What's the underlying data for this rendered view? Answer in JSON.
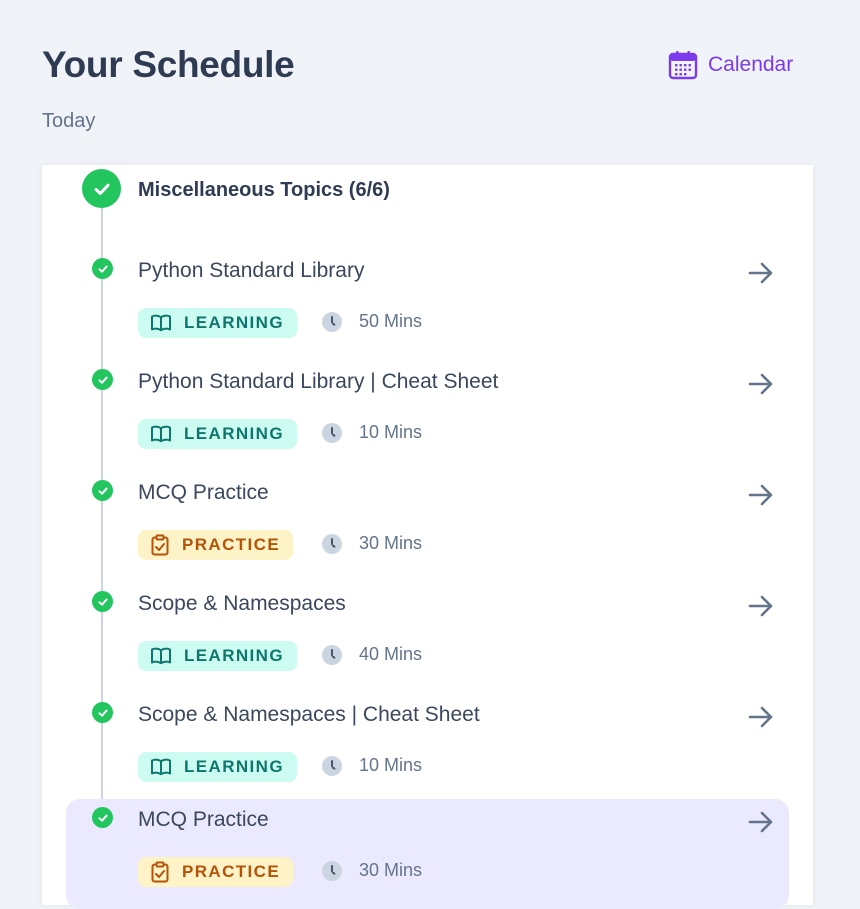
{
  "header": {
    "title": "Your Schedule",
    "calendar_label": "Calendar",
    "calendar_icon": "calendar-icon",
    "subtitle": "Today"
  },
  "group": {
    "title": "Miscellaneous Topics (6/6)",
    "status": "completed"
  },
  "colors": {
    "accent": "#7c3aed",
    "success": "#22c55e",
    "learning_bg": "#ccfbf1",
    "learning_fg": "#0f766e",
    "practice_bg": "#fef3c7",
    "practice_fg": "#b45309",
    "selected_bg": "#ebe9fe"
  },
  "items": [
    {
      "name": "Python Standard Library",
      "type": "LEARNING",
      "duration": "50 Mins",
      "selected": false
    },
    {
      "name": "Python Standard Library | Cheat Sheet",
      "type": "LEARNING",
      "duration": "10 Mins",
      "selected": false
    },
    {
      "name": "MCQ Practice",
      "type": "PRACTICE",
      "duration": "30 Mins",
      "selected": false
    },
    {
      "name": "Scope & Namespaces",
      "type": "LEARNING",
      "duration": "40 Mins",
      "selected": false
    },
    {
      "name": "Scope & Namespaces | Cheat Sheet",
      "type": "LEARNING",
      "duration": "10 Mins",
      "selected": false
    },
    {
      "name": "MCQ Practice",
      "type": "PRACTICE",
      "duration": "30 Mins",
      "selected": true
    }
  ]
}
